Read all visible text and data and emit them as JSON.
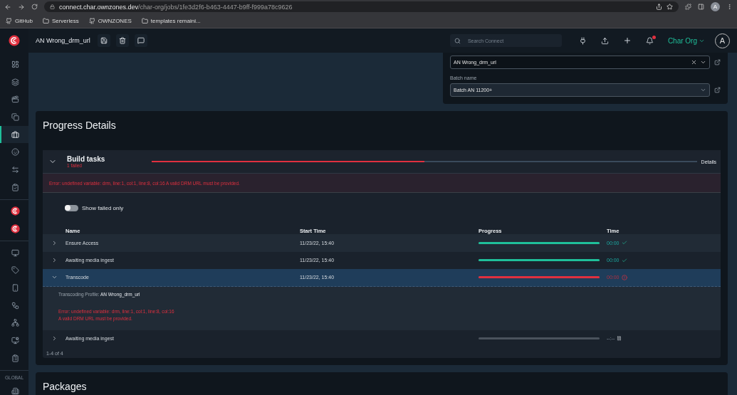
{
  "browser": {
    "url_host": "connect.char.ownzones.dev",
    "url_path": "/char-org/jobs/1fe3d2f6-b463-4447-b9ff-f999a78c9626",
    "avatar": "A",
    "bookmarks": [
      {
        "label": "GitHub",
        "kind": "github"
      },
      {
        "label": "Serverless",
        "kind": "folder"
      },
      {
        "label": "OWNZONES",
        "kind": "github"
      },
      {
        "label": "templates remaini...",
        "kind": "folder"
      }
    ]
  },
  "header": {
    "title": "AN Wrong_drm_url",
    "search": {
      "placeholder": "Search Connect"
    },
    "notification": true,
    "org": "Char Org",
    "avatar": "A"
  },
  "sidebar": {
    "groups": [
      {
        "items": [
          {
            "selected": false
          },
          {
            "selected": false
          },
          {
            "selected": false
          },
          {
            "selected": false
          },
          {
            "selected": true
          },
          {
            "selected": false
          },
          {
            "selected": false
          },
          {
            "selected": false
          }
        ]
      },
      {
        "items": [
          {
            "selected": false
          },
          {
            "selected": false
          }
        ]
      },
      {
        "items": [
          {
            "selected": false
          },
          {
            "selected": false
          },
          {
            "selected": false
          },
          {
            "selected": false
          },
          {
            "selected": false
          },
          {
            "selected": false
          },
          {
            "selected": false
          }
        ]
      },
      {
        "label": "GLOBAL",
        "items": [
          {
            "selected": false
          }
        ]
      }
    ]
  },
  "job_card": {
    "template": {
      "value": "AN Wrong_drm_url"
    },
    "batch": {
      "label": "Batch name",
      "value": "Batch AN 11200+"
    }
  },
  "progress_details": {
    "title": "Progress Details",
    "build_tasks": {
      "title": "Build tasks",
      "status": "1 failed",
      "expanded": true,
      "level": 0.5,
      "details": "Details",
      "error": "Error: undefined variable: drm, line:1, col:1, line:8, col:16 A valid DRM URL must be provided.",
      "show_failed_only": {
        "label": "Show failed only",
        "on": false
      },
      "columns": [
        "Name",
        "Start Time",
        "Progress",
        "Time"
      ],
      "rows": [
        {
          "name": "Ensure Access",
          "start": "11/23/22, 15:40",
          "kind": "done",
          "level": 1,
          "time": "00:00",
          "expanded": false,
          "selected": false
        },
        {
          "name": "Awaiting media ingest",
          "start": "11/23/22, 15:40",
          "kind": "done",
          "level": 1,
          "time": "00:00",
          "expanded": false,
          "selected": false
        },
        {
          "name": "Transcode",
          "start": "11/23/22, 15:40",
          "kind": "failed",
          "level": 1,
          "time": "00:00",
          "expanded": true,
          "selected": true,
          "detail": {
            "profile_label": "Transcoding Profile:",
            "profile": "AN Wrong_drm_url",
            "error_lines": [
              "Error: undefined variable: drm, line:1, col:1, line:8, col:16",
              "A valid DRM URL must be provided."
            ]
          }
        },
        {
          "name": "Awaiting media ingest",
          "kind": "pending",
          "level": 0,
          "time": "--:--",
          "expanded": false,
          "selected": false
        }
      ],
      "pagination": "1-4 of 4"
    }
  },
  "packages": {
    "title": "Packages"
  }
}
